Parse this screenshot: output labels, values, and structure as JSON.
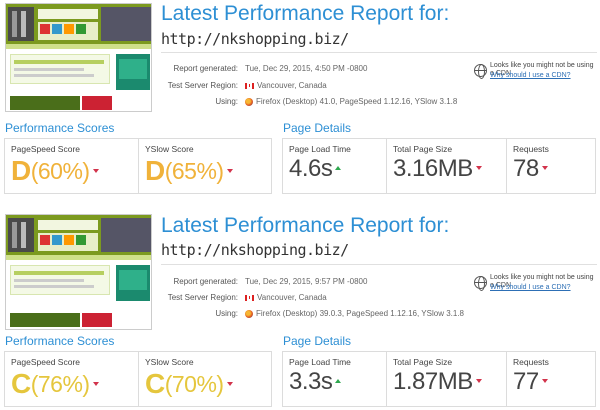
{
  "reports": [
    {
      "title": "Latest Performance Report for:",
      "url": "http://nkshopping.biz/",
      "meta": {
        "generated_label": "Report generated:",
        "generated_value": "Tue, Dec 29, 2015, 4:50 PM -0800",
        "region_label": "Test Server Region:",
        "region_value": "Vancouver, Canada",
        "using_label": "Using:",
        "using_value": "Firefox (Desktop) 41.0, PageSpeed 1.12.16, YSlow 3.1.8"
      },
      "cdn": {
        "text": "Looks like you might not be using a CDN",
        "link": "Why should I use a CDN?"
      },
      "scores_header": "Performance Scores",
      "details_header": "Page Details",
      "pagespeed": {
        "label": "PageSpeed Score",
        "grade": "D",
        "pct": "(60%)"
      },
      "yslow": {
        "label": "YSlow Score",
        "grade": "D",
        "pct": "(65%)"
      },
      "load_time": {
        "label": "Page Load Time",
        "value": "4.6s"
      },
      "page_size": {
        "label": "Total Page Size",
        "value": "3.16MB"
      },
      "requests": {
        "label": "Requests",
        "value": "78"
      }
    },
    {
      "title": "Latest Performance Report for:",
      "url": "http://nkshopping.biz/",
      "meta": {
        "generated_label": "Report generated:",
        "generated_value": "Tue, Dec 29, 2015, 9:57 PM -0800",
        "region_label": "Test Server Region:",
        "region_value": "Vancouver, Canada",
        "using_label": "Using:",
        "using_value": "Firefox (Desktop) 39.0.3, PageSpeed 1.12.16, YSlow 3.1.8"
      },
      "cdn": {
        "text": "Looks like you might not be using a CDN",
        "link": "Why should I use a CDN?"
      },
      "scores_header": "Performance Scores",
      "details_header": "Page Details",
      "pagespeed": {
        "label": "PageSpeed Score",
        "grade": "C",
        "pct": "(76%)"
      },
      "yslow": {
        "label": "YSlow Score",
        "grade": "C",
        "pct": "(70%)"
      },
      "load_time": {
        "label": "Page Load Time",
        "value": "3.3s"
      },
      "page_size": {
        "label": "Total Page Size",
        "value": "1.87MB"
      },
      "requests": {
        "label": "Requests",
        "value": "77"
      }
    }
  ],
  "colors": {
    "accent": "#2d8fd4",
    "grade_d": "#f0b23a",
    "grade_c": "#e5c63d",
    "worse": "#d2334b",
    "better": "#2fa84f"
  }
}
